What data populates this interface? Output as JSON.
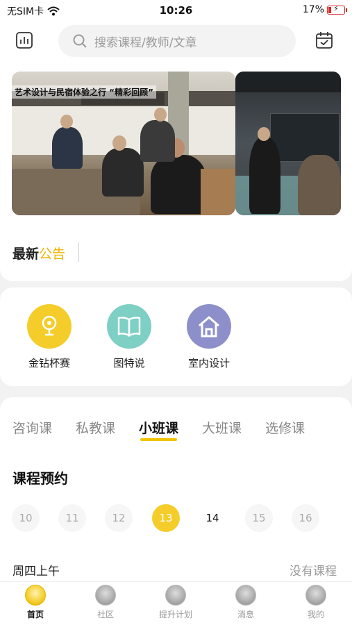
{
  "status_bar": {
    "carrier": "无SIM卡",
    "time": "10:26",
    "battery": "17%",
    "battery_level": 0.17
  },
  "header": {
    "search_placeholder": "搜索课程/教师/文章",
    "left_icon": "chart-icon",
    "right_icon": "calendar-check-icon"
  },
  "banner": {
    "caption": "艺术设计与民宿体验之行 “精彩回顾”"
  },
  "notice": {
    "title_main": "最新",
    "title_accent": "公告"
  },
  "categories": [
    {
      "label": "金钻杯赛",
      "icon": "trophy-icon",
      "color": "#f5cd2a"
    },
    {
      "label": "图特说",
      "icon": "book-icon",
      "color": "#7ecfc4"
    },
    {
      "label": "室内设计",
      "icon": "house-icon",
      "color": "#8d8fca"
    }
  ],
  "course_tabs": [
    "咨询课",
    "私教课",
    "小班课",
    "大班课",
    "选修课"
  ],
  "active_tab": "小班课",
  "booking": {
    "title": "课程预约",
    "dates": [
      "10",
      "11",
      "12",
      "13",
      "14",
      "15",
      "16"
    ],
    "selected": "13",
    "today": "14",
    "slot_label": "周四上午",
    "slot_status": "没有课程"
  },
  "tabbar": {
    "items": [
      {
        "label": "首页",
        "active": true
      },
      {
        "label": "社区",
        "active": false
      },
      {
        "label": "提升计划",
        "active": false
      },
      {
        "label": "消息",
        "active": false
      },
      {
        "label": "我的",
        "active": false
      }
    ]
  },
  "colors": {
    "accent": "#f5cd2a",
    "notice_accent": "#f0b400"
  }
}
